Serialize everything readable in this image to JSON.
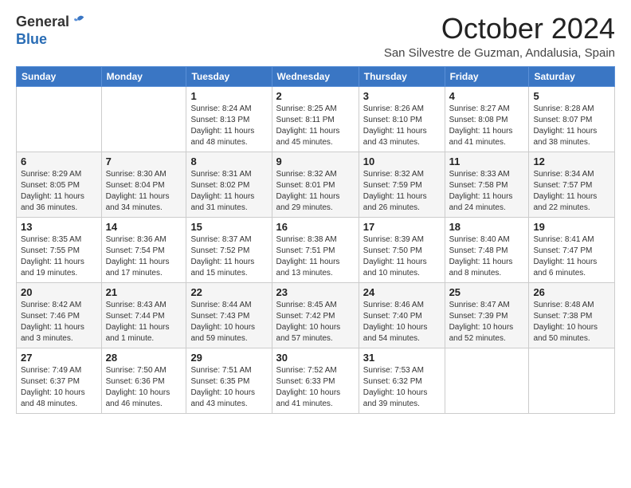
{
  "header": {
    "logo_general": "General",
    "logo_blue": "Blue",
    "month_title": "October 2024",
    "location": "San Silvestre de Guzman, Andalusia, Spain"
  },
  "days_of_week": [
    "Sunday",
    "Monday",
    "Tuesday",
    "Wednesday",
    "Thursday",
    "Friday",
    "Saturday"
  ],
  "weeks": [
    [
      {
        "day": "",
        "info": ""
      },
      {
        "day": "",
        "info": ""
      },
      {
        "day": "1",
        "info": "Sunrise: 8:24 AM\nSunset: 8:13 PM\nDaylight: 11 hours and 48 minutes."
      },
      {
        "day": "2",
        "info": "Sunrise: 8:25 AM\nSunset: 8:11 PM\nDaylight: 11 hours and 45 minutes."
      },
      {
        "day": "3",
        "info": "Sunrise: 8:26 AM\nSunset: 8:10 PM\nDaylight: 11 hours and 43 minutes."
      },
      {
        "day": "4",
        "info": "Sunrise: 8:27 AM\nSunset: 8:08 PM\nDaylight: 11 hours and 41 minutes."
      },
      {
        "day": "5",
        "info": "Sunrise: 8:28 AM\nSunset: 8:07 PM\nDaylight: 11 hours and 38 minutes."
      }
    ],
    [
      {
        "day": "6",
        "info": "Sunrise: 8:29 AM\nSunset: 8:05 PM\nDaylight: 11 hours and 36 minutes."
      },
      {
        "day": "7",
        "info": "Sunrise: 8:30 AM\nSunset: 8:04 PM\nDaylight: 11 hours and 34 minutes."
      },
      {
        "day": "8",
        "info": "Sunrise: 8:31 AM\nSunset: 8:02 PM\nDaylight: 11 hours and 31 minutes."
      },
      {
        "day": "9",
        "info": "Sunrise: 8:32 AM\nSunset: 8:01 PM\nDaylight: 11 hours and 29 minutes."
      },
      {
        "day": "10",
        "info": "Sunrise: 8:32 AM\nSunset: 7:59 PM\nDaylight: 11 hours and 26 minutes."
      },
      {
        "day": "11",
        "info": "Sunrise: 8:33 AM\nSunset: 7:58 PM\nDaylight: 11 hours and 24 minutes."
      },
      {
        "day": "12",
        "info": "Sunrise: 8:34 AM\nSunset: 7:57 PM\nDaylight: 11 hours and 22 minutes."
      }
    ],
    [
      {
        "day": "13",
        "info": "Sunrise: 8:35 AM\nSunset: 7:55 PM\nDaylight: 11 hours and 19 minutes."
      },
      {
        "day": "14",
        "info": "Sunrise: 8:36 AM\nSunset: 7:54 PM\nDaylight: 11 hours and 17 minutes."
      },
      {
        "day": "15",
        "info": "Sunrise: 8:37 AM\nSunset: 7:52 PM\nDaylight: 11 hours and 15 minutes."
      },
      {
        "day": "16",
        "info": "Sunrise: 8:38 AM\nSunset: 7:51 PM\nDaylight: 11 hours and 13 minutes."
      },
      {
        "day": "17",
        "info": "Sunrise: 8:39 AM\nSunset: 7:50 PM\nDaylight: 11 hours and 10 minutes."
      },
      {
        "day": "18",
        "info": "Sunrise: 8:40 AM\nSunset: 7:48 PM\nDaylight: 11 hours and 8 minutes."
      },
      {
        "day": "19",
        "info": "Sunrise: 8:41 AM\nSunset: 7:47 PM\nDaylight: 11 hours and 6 minutes."
      }
    ],
    [
      {
        "day": "20",
        "info": "Sunrise: 8:42 AM\nSunset: 7:46 PM\nDaylight: 11 hours and 3 minutes."
      },
      {
        "day": "21",
        "info": "Sunrise: 8:43 AM\nSunset: 7:44 PM\nDaylight: 11 hours and 1 minute."
      },
      {
        "day": "22",
        "info": "Sunrise: 8:44 AM\nSunset: 7:43 PM\nDaylight: 10 hours and 59 minutes."
      },
      {
        "day": "23",
        "info": "Sunrise: 8:45 AM\nSunset: 7:42 PM\nDaylight: 10 hours and 57 minutes."
      },
      {
        "day": "24",
        "info": "Sunrise: 8:46 AM\nSunset: 7:40 PM\nDaylight: 10 hours and 54 minutes."
      },
      {
        "day": "25",
        "info": "Sunrise: 8:47 AM\nSunset: 7:39 PM\nDaylight: 10 hours and 52 minutes."
      },
      {
        "day": "26",
        "info": "Sunrise: 8:48 AM\nSunset: 7:38 PM\nDaylight: 10 hours and 50 minutes."
      }
    ],
    [
      {
        "day": "27",
        "info": "Sunrise: 7:49 AM\nSunset: 6:37 PM\nDaylight: 10 hours and 48 minutes."
      },
      {
        "day": "28",
        "info": "Sunrise: 7:50 AM\nSunset: 6:36 PM\nDaylight: 10 hours and 46 minutes."
      },
      {
        "day": "29",
        "info": "Sunrise: 7:51 AM\nSunset: 6:35 PM\nDaylight: 10 hours and 43 minutes."
      },
      {
        "day": "30",
        "info": "Sunrise: 7:52 AM\nSunset: 6:33 PM\nDaylight: 10 hours and 41 minutes."
      },
      {
        "day": "31",
        "info": "Sunrise: 7:53 AM\nSunset: 6:32 PM\nDaylight: 10 hours and 39 minutes."
      },
      {
        "day": "",
        "info": ""
      },
      {
        "day": "",
        "info": ""
      }
    ]
  ]
}
